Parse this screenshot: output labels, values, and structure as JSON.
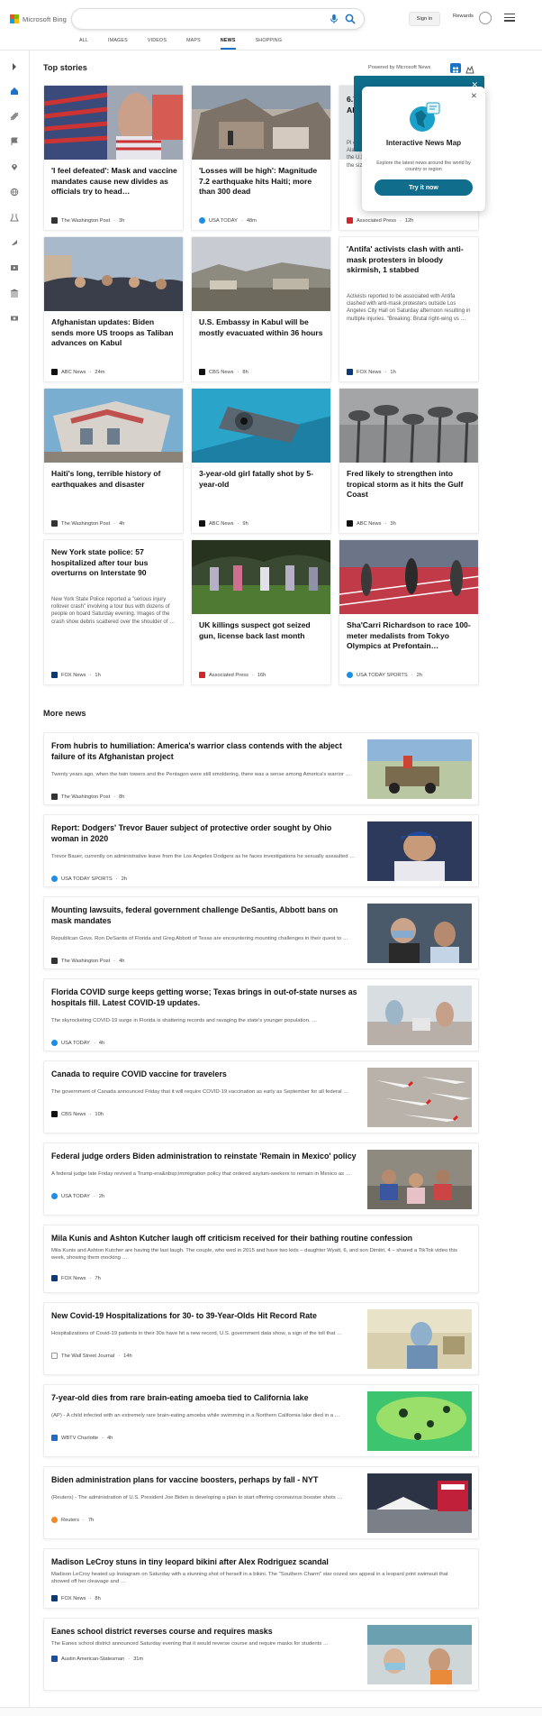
{
  "header": {
    "brand": "Microsoft Bing",
    "signin_label": "Sign in",
    "rewards_label": "Rewards",
    "nav": [
      "ALL",
      "IMAGES",
      "VIDEOS",
      "MAPS",
      "NEWS",
      "SHOPPING"
    ],
    "active_nav": "NEWS"
  },
  "top_stories": {
    "heading": "Top stories",
    "powered_by": "Powered by Microsoft News",
    "cards": [
      {
        "title": "'I feel defeated': Mask and vaccine mandates cause new divides as officials try to head…",
        "source": "The Washington Post",
        "time": "3h"
      },
      {
        "title": "'Losses will be high': Magnitude 7.2 earthquake hits Haiti; more than 300 dead",
        "source": "USA TODAY",
        "time": "48m"
      },
      {
        "title": "6.7 Al is",
        "snippet": "Pl earthq Alaska the U.S the siz",
        "source": "Associated Press",
        "time": "12h"
      },
      {
        "title": "Afghanistan updates: Biden sends more US troops as Taliban advances on Kabul",
        "source": "ABC News",
        "time": "24m"
      },
      {
        "title": "U.S. Embassy in Kabul will be mostly evacuated within 36 hours",
        "source": "CBS News",
        "time": "8h"
      },
      {
        "title": "'Antifa' activists clash with anti-mask protesters in bloody skirmish, 1 stabbed",
        "snippet": "Activists reported to be associated with Antifa clashed with anti-mask protesters outside Los Angeles City Hall on Saturday afternoon resulting in multiple injuries. \"Breaking: Brutal right-wing vs …",
        "source": "FOX News",
        "time": "1h"
      },
      {
        "title": "Haiti's long, terrible history of earthquakes and disaster",
        "source": "The Washington Post",
        "time": "4h"
      },
      {
        "title": "3-year-old girl fatally shot by 5-year-old",
        "source": "ABC News",
        "time": "9h"
      },
      {
        "title": "Fred likely to strengthen into tropical storm as it hits the Gulf Coast",
        "source": "ABC News",
        "time": "3h"
      },
      {
        "title": "New York state police: 57 hospitalized after tour bus overturns on Interstate 90",
        "snippet": "New York State Police reported a \"serious injury rollover crash\" involving a tour bus with dozens of people on board Saturday evening. Images of the crash show debris scattered over the shoulder of …",
        "source": "FOX News",
        "time": "1h"
      },
      {
        "title": "UK killings suspect got seized gun, license back last month",
        "source": "Associated Press",
        "time": "16h"
      },
      {
        "title": "Sha'Carri Richardson to race 100-meter medalists from Tokyo Olympics at Prefontain…",
        "source": "USA TODAY SPORTS",
        "time": "2h"
      }
    ]
  },
  "popup": {
    "title": "Interactive News Map",
    "description": "Explore the latest news around the world by country or region",
    "button": "Try it now"
  },
  "more_news": {
    "heading": "More news",
    "items": [
      {
        "title": "From hubris to humiliation: America's warrior class contends with the abject failure of its Afghanistan project",
        "snippet": "Twenty years ago, when the twin towers and the Pentagon were still smoldering, there was a sense among America's warrior …",
        "source": "The Washington Post",
        "time": "8h"
      },
      {
        "title": "Report: Dodgers' Trevor Bauer subject of protective order sought by Ohio woman in 2020",
        "snippet": "Trevor Bauer, currently on administrative leave from the Los Angeles Dodgers as he faces investigations he sexually assaulted …",
        "source": "USA TODAY SPORTS",
        "time": "2h"
      },
      {
        "title": "Mounting lawsuits, federal government challenge DeSantis, Abbott bans on mask mandates",
        "snippet": "Republican Govs. Ron DeSantis of Florida and Greg Abbott of Texas are encountering mounting challenges in their quest to …",
        "source": "The Washington Post",
        "time": "4h"
      },
      {
        "title": "Florida COVID surge keeps getting worse; Texas brings in out-of-state nurses as hospitals fill. Latest COVID-19 updates.",
        "snippet": "The skyrocketing COVID-19 surge in Florida is shattering records and ravaging the state's younger population. …",
        "source": "USA TODAY",
        "time": "4h"
      },
      {
        "title": "Canada to require COVID vaccine for travelers",
        "snippet": "The government of Canada announced Friday that it will require COVID-19 vaccination as early as September for all federal …",
        "source": "CBS News",
        "time": "10h"
      },
      {
        "title": "Federal judge orders Biden administration to reinstate 'Remain in Mexico' policy",
        "snippet": "A federal judge late Friday revived a Trump-era&nbsp;immigration policy that ordered asylum-seekers to remain in Mexico as …",
        "source": "USA TODAY",
        "time": "2h"
      },
      {
        "title": "Mila Kunis and Ashton Kutcher laugh off criticism received for their bathing routine confession",
        "snippet": "Mila Kunis and Ashton Kutcher are having the last laugh. The couple, who wed in 2015 and have two kids – daughter Wyatt, 6, and son Dimitri, 4 – shared a TikTok video this week, showing them mocking …",
        "source": "FOX News",
        "time": "7h"
      },
      {
        "title": "New Covid-19 Hospitalizations for 30- to 39-Year-Olds Hit Record Rate",
        "snippet": "Hospitalizations of Covid-19 patients in their 30s have hit a new record, U.S. government data show, a sign of the toll that …",
        "source": "The Wall Street Journal",
        "time": "14h"
      },
      {
        "title": "7-year-old dies from rare brain-eating amoeba tied to California lake",
        "snippet": "(AP) - A child infected with an extremely rare brain-eating amoeba while swimming in a Northern California lake died in a …",
        "source": "WBTV Charlotte",
        "time": "4h"
      },
      {
        "title": "Biden administration plans for vaccine boosters, perhaps by fall - NYT",
        "snippet": "(Reuters) - The administration of U.S. President Joe Biden is developing a plan to start offering coronavirus booster shots …",
        "source": "Reuters",
        "time": "7h"
      },
      {
        "title": "Madison LeCroy stuns in tiny leopard bikini after Alex Rodriguez scandal",
        "snippet": "Madison LeCroy heated up Instagram on Saturday with a stunning shot of herself in a bikini. The \"Southern Charm\" star oozed sex appeal in a leopard print swimsuit that showed off her cleavage and …",
        "source": "FOX News",
        "time": "8h"
      },
      {
        "title": "Eanes school district reverses course and requires masks",
        "snippet": "The Eanes school district announced Saturday evening that it would reverse course and require masks for students …",
        "source": "Austin American-Statesman",
        "time": "31m"
      }
    ]
  },
  "colors": {
    "accent": "#1a73c5",
    "map_banner": "#0e6e8c",
    "popup_button": "#106d8c"
  }
}
